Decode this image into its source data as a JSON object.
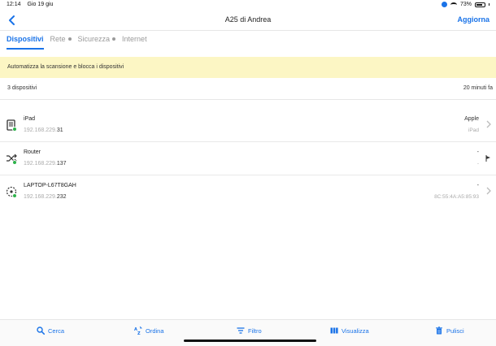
{
  "status_bar": {
    "time": "12:14",
    "date": "Gio 19 giu",
    "battery": "73%",
    "battery_level": 0.73
  },
  "nav": {
    "title": "A25 di Andrea",
    "action": "Aggiorna"
  },
  "tabs": [
    {
      "label": "Dispositivi",
      "active": true
    },
    {
      "label": "Rete",
      "dot": true
    },
    {
      "label": "Sicurezza",
      "dot": true
    },
    {
      "label": "Internet"
    }
  ],
  "banner": {
    "text": "Automatizza la scansione e blocca i dispositivi"
  },
  "summary": {
    "count": "3 dispositivi",
    "time": "20 minuti fa"
  },
  "devices": [
    {
      "name": "iPad",
      "ip_prefix": "192.168.229.",
      "ip_last": "31",
      "vendor": "Apple",
      "detail": "iPad",
      "icon": "tablet-icon",
      "status": "online",
      "trailing": "chevron"
    },
    {
      "name": "Router",
      "ip_prefix": "192.168.229.",
      "ip_last": "137",
      "vendor": "-",
      "detail": "-",
      "icon": "router-icon",
      "status": "online",
      "trailing": "flag"
    },
    {
      "name": "LAPTOP-L67T8GAH",
      "ip_prefix": "192.168.229.",
      "ip_last": "232",
      "vendor": "-",
      "detail": "8C:55:4A:A5:85:93",
      "icon": "unknown-device-icon",
      "status": "online",
      "trailing": "chevron"
    }
  ],
  "toolbar": {
    "search": "Cerca",
    "sort": "Ordina",
    "filter": "Filtro",
    "view": "Visualizza",
    "clean": "Pulisci"
  },
  "colors": {
    "accent": "#1a73e8",
    "banner": "#fcf6c4",
    "online": "#2db24a"
  }
}
